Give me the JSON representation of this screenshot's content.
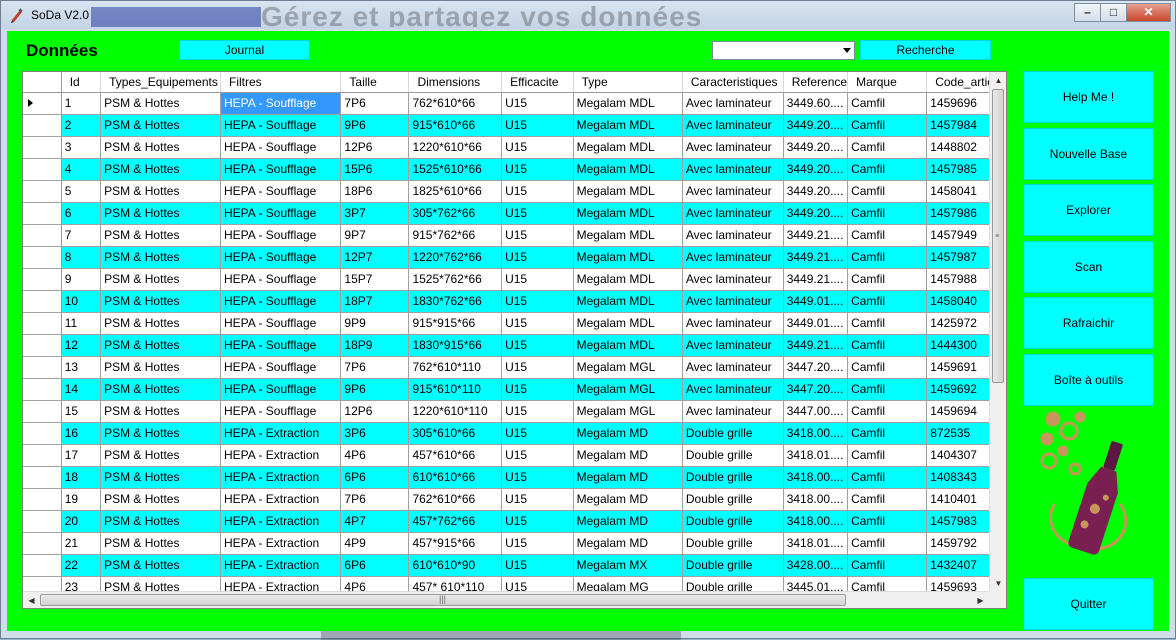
{
  "window": {
    "title": "SoDa V2.0",
    "ghost_title": "Gérez et partagez vos données"
  },
  "header": {
    "heading": "Données",
    "journal_label": "Journal",
    "search_label": "Recherche",
    "search_combo_value": ""
  },
  "table": {
    "columns": [
      "Id",
      "Types_Equipements",
      "Filtres",
      "Taille",
      "Dimensions",
      "Efficacite",
      "Type",
      "Caracteristiques",
      "Reference",
      "Marque",
      "Code_articl"
    ],
    "rows": [
      [
        "1",
        "PSM & Hottes",
        "HEPA - Soufflage",
        "7P6",
        "762*610*66",
        "U15",
        "Megalam MDL",
        "Avec laminateur",
        "3449.60....",
        "Camfil",
        "1459696"
      ],
      [
        "2",
        "PSM & Hottes",
        "HEPA - Soufflage",
        "9P6",
        " 915*610*66",
        "U15",
        "Megalam MDL",
        "Avec laminateur",
        "3449.20....",
        "Camfil",
        "1457984"
      ],
      [
        "3",
        "PSM & Hottes",
        "HEPA - Soufflage",
        "12P6",
        " 1220*610*66",
        "U15",
        "Megalam MDL",
        "Avec laminateur",
        "3449.20....",
        "Camfil",
        "1448802"
      ],
      [
        "4",
        "PSM & Hottes",
        "HEPA - Soufflage",
        "15P6",
        " 1525*610*66",
        "U15",
        "Megalam MDL",
        "Avec laminateur",
        "3449.20....",
        "Camfil",
        "1457985"
      ],
      [
        "5",
        "PSM & Hottes",
        "HEPA - Soufflage",
        "18P6",
        " 1825*610*66",
        "U15",
        "Megalam MDL",
        "Avec laminateur",
        "3449.20....",
        "Camfil",
        "1458041"
      ],
      [
        "6",
        "PSM & Hottes",
        "HEPA - Soufflage",
        "3P7",
        " 305*762*66",
        "U15",
        "Megalam MDL",
        "Avec laminateur",
        "3449.20....",
        "Camfil",
        "1457986"
      ],
      [
        "7",
        "PSM & Hottes",
        "HEPA - Soufflage",
        "9P7",
        " 915*762*66",
        "U15",
        "Megalam MDL",
        "Avec laminateur",
        "3449.21....",
        "Camfil",
        "1457949"
      ],
      [
        "8",
        "PSM & Hottes",
        "HEPA - Soufflage",
        "12P7",
        "1220*762*66",
        "U15",
        "Megalam MDL",
        "Avec laminateur",
        "3449.21....",
        "Camfil",
        "1457987"
      ],
      [
        "9",
        "PSM & Hottes",
        "HEPA - Soufflage",
        "15P7",
        "1525*762*66",
        "U15",
        "Megalam MDL",
        "Avec laminateur",
        "3449.21....",
        "Camfil",
        "1457988"
      ],
      [
        "10",
        "PSM & Hottes",
        "HEPA - Soufflage",
        "18P7",
        " 1830*762*66",
        "U15",
        "Megalam MDL",
        "Avec laminateur",
        "3449.01....",
        "Camfil",
        "1458040"
      ],
      [
        "11",
        "PSM & Hottes",
        "HEPA - Soufflage",
        "9P9",
        " 915*915*66",
        "U15",
        "Megalam MDL",
        "Avec laminateur",
        "3449.01....",
        "Camfil",
        "1425972"
      ],
      [
        "12",
        "PSM & Hottes",
        "HEPA - Soufflage",
        "18P9",
        " 1830*915*66",
        "U15",
        "Megalam MDL",
        "Avec laminateur",
        "3449.21....",
        "Camfil",
        "1444300"
      ],
      [
        "13",
        "PSM & Hottes",
        "HEPA - Soufflage",
        "7P6",
        "762*610*110",
        "U15",
        "Megalam MGL",
        "Avec laminateur",
        "3447.20....",
        "Camfil",
        "1459691"
      ],
      [
        "14",
        "PSM & Hottes",
        "HEPA - Soufflage",
        "9P6",
        "915*610*110",
        "U15",
        "Megalam MGL",
        "Avec laminateur",
        "3447.20....",
        "Camfil",
        "1459692"
      ],
      [
        "15",
        "PSM & Hottes",
        "HEPA - Soufflage",
        "12P6",
        "1220*610*110",
        "U15",
        "Megalam MGL",
        "Avec laminateur",
        "3447.00....",
        "Camfil",
        "1459694"
      ],
      [
        "16",
        "PSM & Hottes",
        "HEPA - Extraction",
        "3P6",
        "305*610*66",
        "U15",
        "Megalam MD",
        "Double grille",
        "3418.00....",
        "Camfil",
        "872535"
      ],
      [
        "17",
        "PSM & Hottes",
        "HEPA - Extraction",
        "4P6",
        "457*610*66",
        "U15",
        "Megalam MD",
        "Double grille",
        "3418.01....",
        "Camfil",
        "1404307"
      ],
      [
        "18",
        "PSM & Hottes",
        "HEPA - Extraction",
        "6P6",
        "610*610*66",
        "U15",
        "Megalam MD",
        "Double grille",
        "3418.00....",
        "Camfil",
        "1408343"
      ],
      [
        "19",
        "PSM & Hottes",
        "HEPA - Extraction",
        "7P6",
        "762*610*66",
        "U15",
        "Megalam MD",
        "Double grille",
        "3418.00....",
        "Camfil",
        "1410401"
      ],
      [
        "20",
        "PSM & Hottes",
        "HEPA - Extraction",
        "4P7",
        " 457*762*66",
        "U15",
        "Megalam MD",
        "Double grille",
        "3418.00....",
        "Camfil",
        "1457983"
      ],
      [
        "21",
        "PSM & Hottes",
        "HEPA - Extraction",
        "4P9",
        "457*915*66",
        "U15",
        "Megalam MD",
        "Double grille",
        "3418.01....",
        "Camfil",
        "1459792"
      ],
      [
        "22",
        "PSM & Hottes",
        "HEPA - Extraction",
        "6P6",
        "610*610*90",
        "U15",
        "Megalam MX",
        "Double grille",
        "3428.00....",
        "Camfil",
        "1432407"
      ],
      [
        "23",
        "PSM & Hottes",
        "HEPA - Extraction",
        "4P6",
        "457* 610*110",
        "U15",
        "Megalam MG",
        "Double grille",
        "3445.01....",
        "Camfil",
        "1459693"
      ]
    ]
  },
  "sidebar": {
    "buttons": [
      "Help Me !",
      "Nouvelle Base",
      "Explorer",
      "Scan",
      "Rafraichir",
      "Boîte à outils"
    ],
    "quit_label": "Quitter"
  },
  "colors": {
    "background": "#00ff00",
    "button": "#00ffff",
    "row_alt": "#00ffff",
    "selection": "#3399ff",
    "logo_wine": "#7a1f52",
    "logo_bubbles": "#c8965a"
  },
  "icons": {
    "app": "soda-app-icon",
    "logo": "wine-bottle-logo"
  }
}
